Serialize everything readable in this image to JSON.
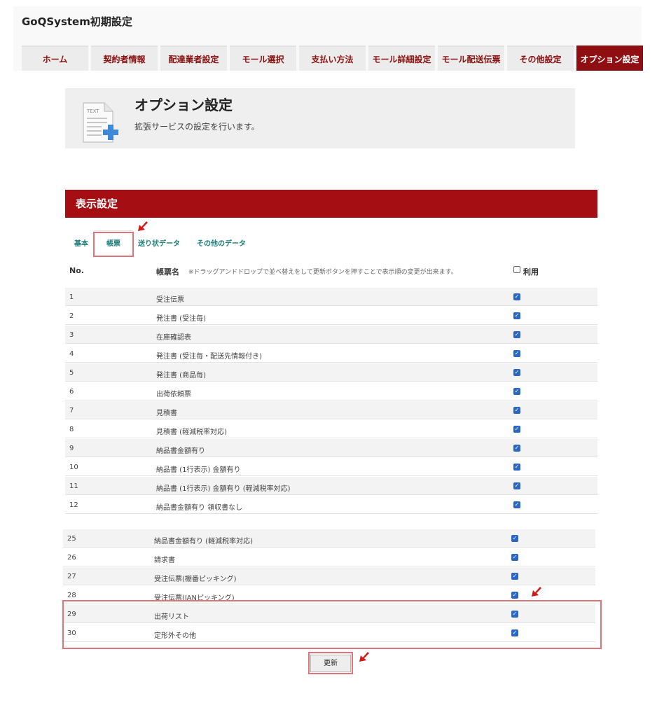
{
  "app": {
    "title": "GoQSystem初期設定"
  },
  "tabs": [
    {
      "label": "ホーム",
      "active": false
    },
    {
      "label": "契約者情報",
      "active": false
    },
    {
      "label": "配達業者設定",
      "active": false
    },
    {
      "label": "モール選択",
      "active": false
    },
    {
      "label": "支払い方法",
      "active": false
    },
    {
      "label": "モール詳細設定",
      "active": false
    },
    {
      "label": "モール配送伝票",
      "active": false
    },
    {
      "label": "その他設定",
      "active": false
    },
    {
      "label": "オプション設定",
      "active": true
    }
  ],
  "hero": {
    "title": "オプション設定",
    "subtitle": "拡張サービスの設定を行います。",
    "icon": "text-document-plus-icon",
    "icon_text": "TEXT"
  },
  "section": {
    "title": "表示設定"
  },
  "subtabs": {
    "items": [
      "基本",
      "帳票",
      "送り状データ",
      "その他のデータ"
    ],
    "active": "帳票"
  },
  "table": {
    "headers": {
      "no": "No.",
      "name": "帳票名",
      "note": "※ドラッグアンドドロップで並べ替えをして更新ボタンを押すことで表示順の変更が出来ます。",
      "use": "利用"
    },
    "rows_top": [
      {
        "no": "1",
        "name": "受注伝票",
        "checked": true
      },
      {
        "no": "2",
        "name": "発注書 (受注毎)",
        "checked": true
      },
      {
        "no": "3",
        "name": "在庫確認表",
        "checked": true
      },
      {
        "no": "4",
        "name": "発注書 (受注毎・配送先情報付き)",
        "checked": true
      },
      {
        "no": "5",
        "name": "発注書 (商品毎)",
        "checked": true
      },
      {
        "no": "6",
        "name": "出荷依頼票",
        "checked": true
      },
      {
        "no": "7",
        "name": "見積書",
        "checked": true
      },
      {
        "no": "8",
        "name": "見積書 (軽減税率対応)",
        "checked": true
      },
      {
        "no": "9",
        "name": "納品書金額有り",
        "checked": true
      },
      {
        "no": "10",
        "name": "納品書 (1行表示) 金額有り",
        "checked": true
      },
      {
        "no": "11",
        "name": "納品書 (1行表示) 金額有り (軽減税率対応)",
        "checked": true
      },
      {
        "no": "12",
        "name": "納品書金額有り 領収書なし",
        "checked": true
      }
    ],
    "rows_bottom": [
      {
        "no": "25",
        "name": "納品書金額有り (軽減税率対応)",
        "checked": true
      },
      {
        "no": "26",
        "name": "請求書",
        "checked": true
      },
      {
        "no": "27",
        "name": "受注伝票(棚番ピッキング)",
        "checked": true
      },
      {
        "no": "28",
        "name": "受注伝票(JANピッキング)",
        "checked": true
      },
      {
        "no": "29",
        "name": "出荷リスト",
        "checked": true
      },
      {
        "no": "30",
        "name": "定形外その他",
        "checked": true
      }
    ]
  },
  "buttons": {
    "update": "更新"
  },
  "colors": {
    "accent": "#a50f14",
    "tab_active": "#8e0e12",
    "highlight": "#e07478",
    "checkbox": "#2a67c4"
  }
}
